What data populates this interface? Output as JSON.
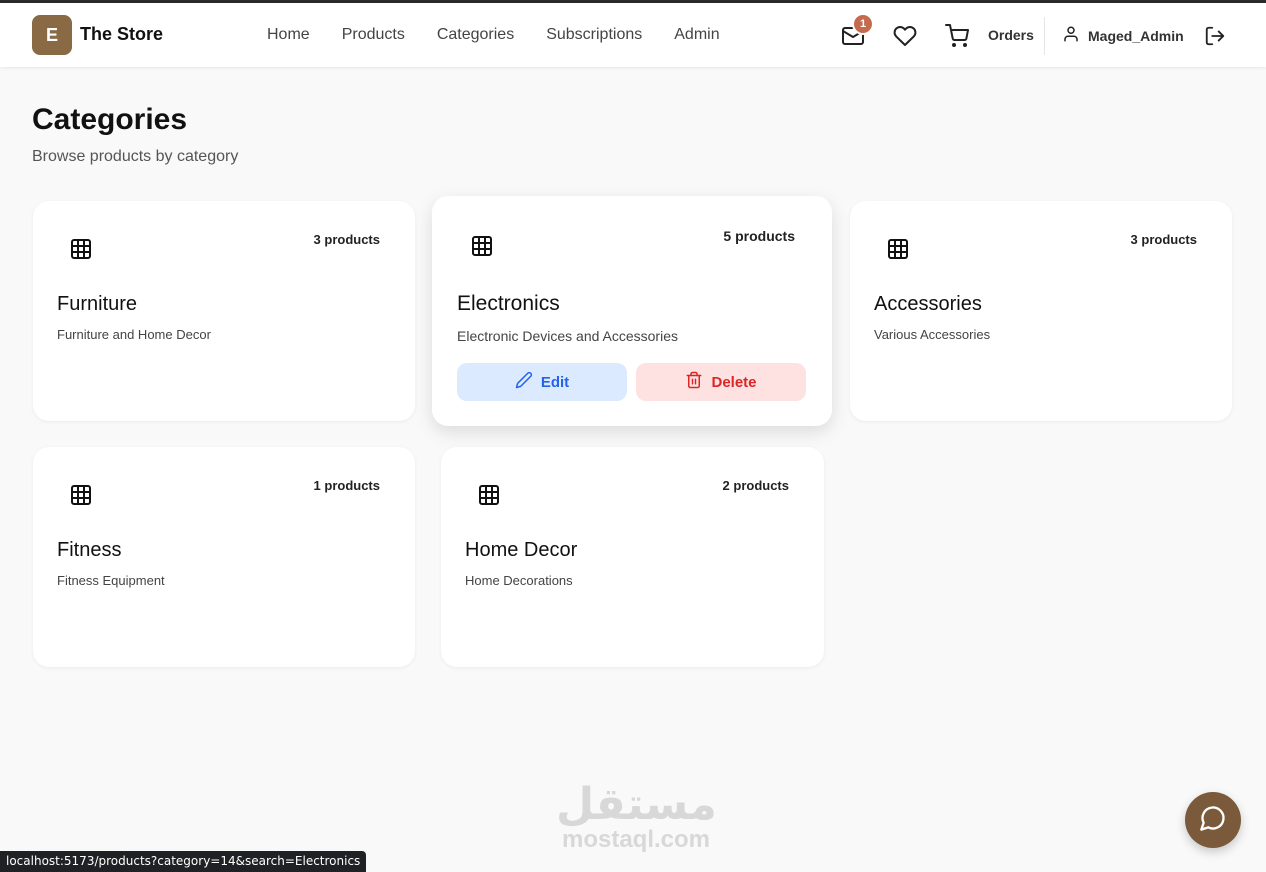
{
  "header": {
    "logo_letter": "E",
    "brand": "The Store",
    "nav": [
      "Home",
      "Products",
      "Categories",
      "Subscriptions",
      "Admin"
    ],
    "mail_badge": "1",
    "orders_label": "Orders",
    "username": "Maged_Admin",
    "icons": [
      "mail-icon",
      "heart-icon",
      "cart-icon",
      "user-icon",
      "logout-icon"
    ]
  },
  "page": {
    "title": "Categories",
    "subtitle": "Browse products by category"
  },
  "categories": [
    {
      "name": "Furniture",
      "description": "Furniture and Home Decor",
      "count": "3 products"
    },
    {
      "name": "Electronics",
      "description": "Electronic Devices and Accessories",
      "count": "5 products",
      "edit_label": "Edit",
      "delete_label": "Delete"
    },
    {
      "name": "Accessories",
      "description": "Various Accessories",
      "count": "3 products"
    },
    {
      "name": "Fitness",
      "description": "Fitness Equipment",
      "count": "1 products"
    },
    {
      "name": "Home Decor",
      "description": "Home Decorations",
      "count": "2 products"
    }
  ],
  "watermark": {
    "arabic": "مستقل",
    "latin": "mostaql.com"
  },
  "status_url": "localhost:5173/products?category=14&search=Electronics",
  "colors": {
    "brand": "#8a6a45",
    "badge": "#c46b4e",
    "edit": "#2563eb",
    "delete": "#dc2626",
    "chat": "#7a5a3a"
  }
}
